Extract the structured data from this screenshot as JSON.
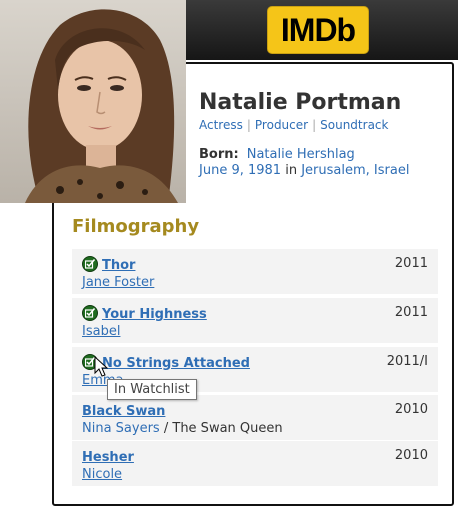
{
  "imdb_logo": "IMDb",
  "person": {
    "name": "Natalie Portman",
    "roles": [
      "Actress",
      "Producer",
      "Soundtrack"
    ],
    "born_label": "Born:",
    "birth_name": "Natalie Hershlag",
    "birth_date": "June 9, 1981",
    "birth_in": "in",
    "birth_place": "Jerusalem, Israel"
  },
  "filmography": {
    "title": "Filmography",
    "films": [
      {
        "title": "Thor",
        "role": "Jane Foster",
        "year": "2011",
        "in_watchlist": true
      },
      {
        "title": "Your Highness",
        "role": "Isabel",
        "year": "2011",
        "in_watchlist": true
      },
      {
        "title": "No Strings Attached",
        "role": "Emma",
        "year": "2011/I",
        "in_watchlist": true
      },
      {
        "title": "Black Swan",
        "role": "Nina Sayers",
        "role_sep": "/",
        "role_alt": "The Swan Queen",
        "year": "2010",
        "in_watchlist": false
      },
      {
        "title": "Hesher",
        "role": "Nicole",
        "year": "2010",
        "in_watchlist": false
      }
    ]
  },
  "tooltip": "In Watchlist",
  "colors": {
    "link": "#2f6eb5",
    "heading_gold": "#a58a1f",
    "imdb_yellow": "#f5c518",
    "watchlist_green": "#1f6b1f"
  }
}
